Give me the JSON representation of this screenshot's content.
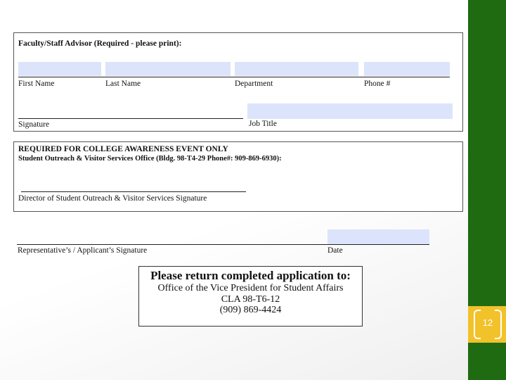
{
  "advisor_section": {
    "heading": "Faculty/Staff Advisor (Required - please print):",
    "labels": {
      "first_name": "First Name",
      "last_name": "Last Name",
      "department": "Department",
      "phone": "Phone #",
      "signature": "Signature",
      "job_title": "Job Title"
    }
  },
  "awareness_section": {
    "heading": "REQUIRED FOR COLLEGE AWARENESS EVENT ONLY",
    "office_line": "Student Outreach & Visitor Services Office (Bldg. 98-T4-29 Phone#: 909-869-6930):",
    "signature_label": "Director of Student Outreach & Visitor Services Signature"
  },
  "applicant_section": {
    "signature_label": "Representative’s / Applicant’s Signature",
    "date_label": "Date"
  },
  "return_box": {
    "title": "Please return completed application to:",
    "lines": [
      "Office of the Vice President for Student Affairs",
      "CLA 98-T6-12",
      "(909) 869-4424"
    ]
  },
  "slide": {
    "page_number": "12"
  },
  "colors": {
    "sidebar": "#1f6b12",
    "accent": "#f2c22a",
    "field_fill": "#dbe4fb"
  }
}
